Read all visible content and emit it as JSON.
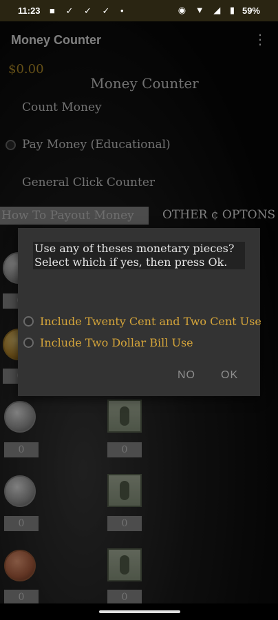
{
  "status": {
    "time": "11:23",
    "notification_glyphs": "■ ✓ ✓ ✓ •",
    "system_glyphs": "◉ ▼ ◢ ▮",
    "battery": "59%"
  },
  "appbar": {
    "title": "Money Counter",
    "menu_icon": "⋮"
  },
  "main": {
    "amount": "$0.00",
    "heading": "Money Counter",
    "modes": [
      "Count Money",
      "Pay Money (Educational)",
      "General Click Counter"
    ],
    "how_to_button": "How To Payout Money",
    "other_options_button": "OTHER ¢ OPTONS"
  },
  "grid": {
    "counts": [
      "0",
      "0",
      "0",
      "0",
      "0",
      "0",
      "0",
      "0",
      "0",
      "0"
    ]
  },
  "dialog": {
    "message": "Use any of theses monetary pieces? Select which if yes, then press Ok.",
    "options": [
      "Include Twenty Cent and Two Cent Use",
      "Include Two Dollar Bill Use"
    ],
    "no_label": "NO",
    "ok_label": "OK"
  },
  "colors": {
    "accent_gold": "#d5a53a",
    "amount": "#b8922a",
    "status_bar": "#2a2512"
  }
}
